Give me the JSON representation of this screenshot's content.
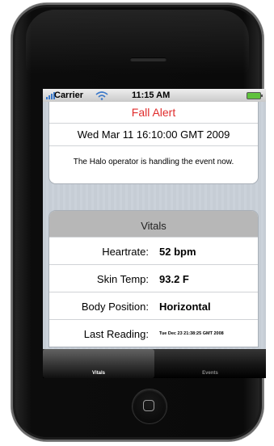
{
  "status_bar": {
    "carrier": "Carrier",
    "time": "11:15 AM"
  },
  "alert": {
    "title": "Fall Alert",
    "datetime": "Wed Mar 11 16:10:00 GMT 2009",
    "message": "The Halo operator is handling the event now."
  },
  "vitals": {
    "header": "Vitals",
    "rows": [
      {
        "label": "Heartrate:",
        "value": "52 bpm"
      },
      {
        "label": "Skin Temp:",
        "value": "93.2 F"
      },
      {
        "label": "Body Position:",
        "value": "Horizontal"
      },
      {
        "label": "Last Reading:",
        "value": "Tue Dec 23 21:38:25 GMT 2008"
      }
    ]
  },
  "tabs": [
    {
      "label": "Vitals",
      "selected": true
    },
    {
      "label": "Events",
      "selected": false
    }
  ],
  "colors": {
    "alert_title": "#e02d2d",
    "battery": "#5fc23c",
    "vitals_header_bg": "#b7b7b7"
  }
}
